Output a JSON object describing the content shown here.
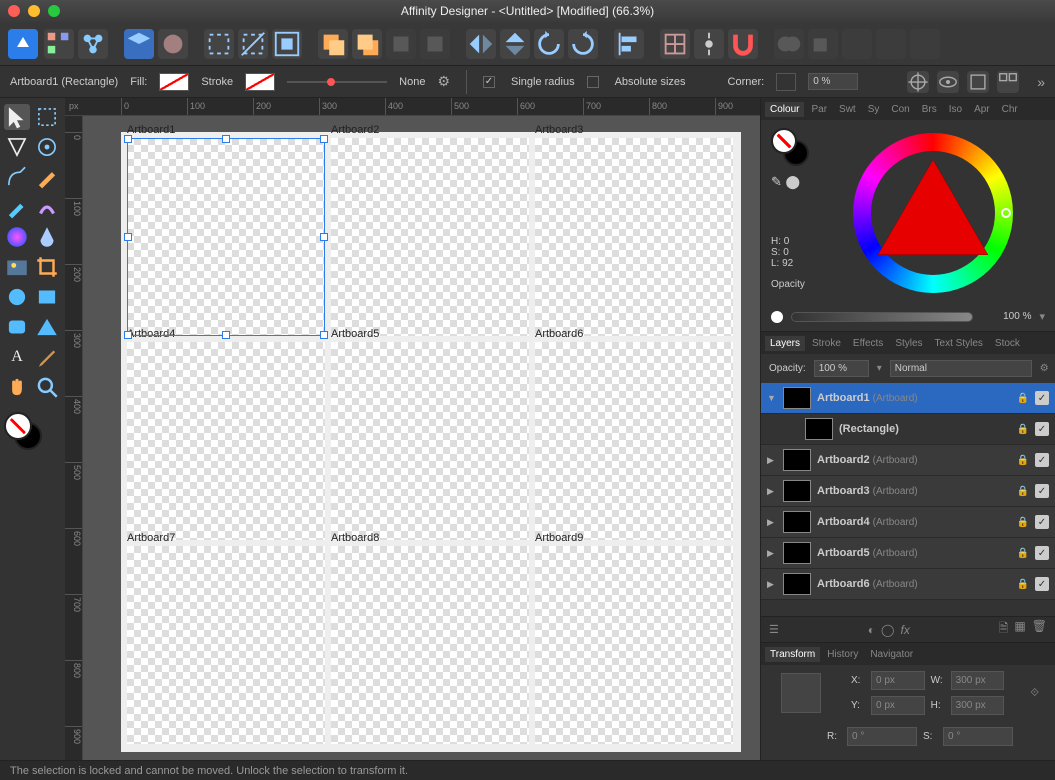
{
  "title": "Affinity Designer - <Untitled> [Modified] (66.3%)",
  "context": {
    "selection": "Artboard1 (Rectangle)",
    "fill_label": "Fill:",
    "stroke_label": "Stroke",
    "stroke_width": "None",
    "single_radius": "Single radius",
    "absolute_sizes": "Absolute sizes",
    "corner_label": "Corner:",
    "corner_value": "0 %"
  },
  "ruler_unit": "px",
  "ruler_h": [
    "0",
    "100",
    "200",
    "300",
    "400",
    "500",
    "600",
    "700",
    "800",
    "900"
  ],
  "ruler_v": [
    "0",
    "100",
    "200",
    "300",
    "400",
    "500",
    "600",
    "700",
    "800",
    "900"
  ],
  "artboards": [
    "Artboard1",
    "Artboard2",
    "Artboard3",
    "Artboard4",
    "Artboard5",
    "Artboard6",
    "Artboard7",
    "Artboard8",
    "Artboard9"
  ],
  "colour": {
    "tabs": [
      "Colour",
      "Par",
      "Swt",
      "Sy",
      "Con",
      "Brs",
      "Iso",
      "Apr",
      "Chr"
    ],
    "h": "H: 0",
    "s": "S: 0",
    "l": "L: 92",
    "opacity_label": "Opacity",
    "opacity_value": "100 %"
  },
  "layers": {
    "tabs": [
      "Layers",
      "Stroke",
      "Effects",
      "Styles",
      "Text Styles",
      "Stock"
    ],
    "opacity_label": "Opacity:",
    "opacity_value": "100 %",
    "blend": "Normal",
    "items": [
      {
        "name": "Artboard1",
        "sub": "(Artboard)",
        "sel": true,
        "exp": true,
        "lock": true
      },
      {
        "name": "(Rectangle)",
        "sub": "",
        "sel": false,
        "child": true,
        "lock": true
      },
      {
        "name": "Artboard2",
        "sub": "(Artboard)",
        "lock": true
      },
      {
        "name": "Artboard3",
        "sub": "(Artboard)",
        "lock": true
      },
      {
        "name": "Artboard4",
        "sub": "(Artboard)",
        "lock": true
      },
      {
        "name": "Artboard5",
        "sub": "(Artboard)",
        "lock": true
      },
      {
        "name": "Artboard6",
        "sub": "(Artboard)",
        "lock": true
      }
    ]
  },
  "transform": {
    "tabs": [
      "Transform",
      "History",
      "Navigator"
    ],
    "x_label": "X:",
    "x": "0 px",
    "y_label": "Y:",
    "y": "0 px",
    "w_label": "W:",
    "w": "300 px",
    "h_label": "H:",
    "h": "300 px",
    "r_label": "R:",
    "r": "0 °",
    "s_label": "S:",
    "s": "0 °"
  },
  "status": "The selection is locked and cannot be moved. Unlock the selection to transform it."
}
